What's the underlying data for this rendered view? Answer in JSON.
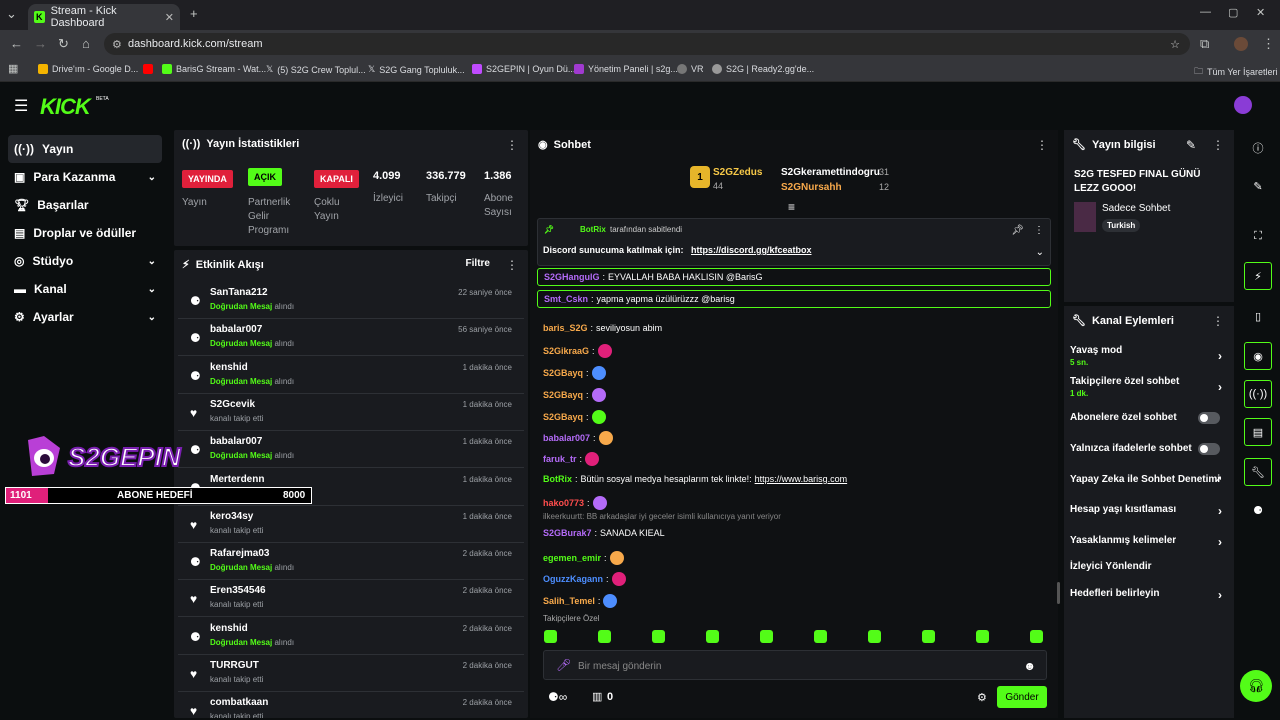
{
  "browser": {
    "tab_title": "Stream - Kick Dashboard",
    "url": "dashboard.kick.com/stream",
    "bookmarks": [
      "Drive'ım - Google D...",
      "BarisG Stream - Wat...",
      "(5) S2G Crew Toplul...",
      "S2G Gang Topluluk...",
      "S2GEPIN | Oyun Dü...",
      "Yönetim Paneli | s2g...",
      "VR",
      "S2G | Ready2.gg'de..."
    ],
    "all_bookmarks": "Tüm Yer İşaretleri"
  },
  "logo": "KICK",
  "beta": "BETA",
  "sidebar": {
    "items": [
      "Yayın",
      "Para Kazanma",
      "Başarılar",
      "Droplar ve ödüller",
      "Stüdyo",
      "Kanal",
      "Ayarlar"
    ]
  },
  "stats": {
    "title": "Yayın İstatistikleri",
    "badges": [
      "YAYINDA",
      "AÇIK",
      "KAPALI"
    ],
    "labels": [
      "Yayın",
      "Partnerlik Gelir Programı",
      "Çoklu Yayın",
      "İzleyici",
      "Takipçi",
      "Abone Sayısı"
    ],
    "values": [
      "4.099",
      "336.779",
      "1.386"
    ]
  },
  "activity": {
    "title": "Etkinlik Akışı",
    "filter": "Filtre",
    "rows": [
      {
        "user": "SanTana212",
        "type": "dm",
        "time": "22 saniye önce"
      },
      {
        "user": "babalar007",
        "type": "dm",
        "time": "56 saniye önce"
      },
      {
        "user": "kenshid",
        "type": "dm",
        "time": "1 dakika önce"
      },
      {
        "user": "S2Gcevik",
        "type": "follow",
        "time": "1 dakika önce"
      },
      {
        "user": "babalar007",
        "type": "dm",
        "time": "1 dakika önce"
      },
      {
        "user": "Merterdenn",
        "type": "dm",
        "time": "1 dakika önce"
      },
      {
        "user": "kero34sy",
        "type": "follow",
        "time": "1 dakika önce"
      },
      {
        "user": "Rafarejma03",
        "type": "dm",
        "time": "2 dakika önce"
      },
      {
        "user": "Eren354546",
        "type": "follow",
        "time": "2 dakika önce"
      },
      {
        "user": "kenshid",
        "type": "dm",
        "time": "2 dakika önce"
      },
      {
        "user": "TURRGUT",
        "type": "follow",
        "time": "2 dakika önce"
      },
      {
        "user": "combatkaan",
        "type": "follow",
        "time": "2 dakika önce"
      }
    ],
    "dm_bold": "Doğrudan Mesaj",
    "dm_rest": "alındı",
    "follow_text": "kanalı takip etti"
  },
  "overlay": {
    "logo_text": "S2GEPIN",
    "goal_current": "1101",
    "goal_label": "ABONE HEDEFİ",
    "goal_target": "8000",
    "goal_fraction": 0.1376
  },
  "chat": {
    "title": "Sohbet",
    "leaders": [
      {
        "name": "S2GZedus",
        "count": "44",
        "rank": "1"
      },
      {
        "name": "S2Gkeramettindogru",
        "count": "31"
      },
      {
        "name": "S2GNursahh",
        "count": "12"
      }
    ],
    "pinned_by": "BotRix",
    "pinned_suffix": "tarafından sabitlendi",
    "pinned_text": "Discord sunucuma katılmak için:",
    "pinned_link": "https://discord.gg/kfceatbox",
    "messages": [
      {
        "user": "S2GHangulG",
        "color": "#b46bf8",
        "text": "EYVALLAH BABA HAKLISIN @BarisG"
      },
      {
        "user": "Smt_Cskn",
        "color": "#b46bf8",
        "text": "yapma yapma üzülürüzzz @barisg"
      },
      {
        "user": "baris_S2G",
        "color": "#f7a94b",
        "text": "seviliyosun abim"
      },
      {
        "user": "S2GikraaG",
        "color": "#f7a94b",
        "text": ""
      },
      {
        "user": "S2GBayq",
        "color": "#f7a94b",
        "text": ""
      },
      {
        "user": "S2GBayq",
        "color": "#f7a94b",
        "text": ""
      },
      {
        "user": "S2GBayq",
        "color": "#f7a94b",
        "text": ""
      },
      {
        "user": "babalar007",
        "color": "#b46bf8",
        "text": ""
      },
      {
        "user": "faruk_tr",
        "color": "#b46bf8",
        "text": ""
      },
      {
        "user": "BotRix",
        "color": "#53fc18",
        "text": "Bütün sosyal medya hesaplarım tek linkte!:",
        "link": "https://www.barisg.com"
      },
      {
        "user": "hako0773",
        "color": "#ff4d4d",
        "text": ""
      },
      {
        "user": "S2GBurak7",
        "color": "#b46bf8",
        "text": "SANADA KIEAL"
      },
      {
        "user": "egemen_emir",
        "color": "#53fc18",
        "text": ""
      },
      {
        "user": "OguzzKagann",
        "color": "#4d8eff",
        "text": ""
      },
      {
        "user": "Salih_Temel",
        "color": "#f7a94b",
        "text": ""
      }
    ],
    "reply_hint": "ilkeerkuurtt: BB arkadaşlar iyi geceler isimli kullanıcıya yanıt veriyor",
    "followers_only": "Takipçilere Özel",
    "placeholder": "Bir mesaj gönderin",
    "count": "0",
    "send": "Gönder"
  },
  "info": {
    "title": "Yayın bilgisi",
    "stream_title": "S2G TESFED FINAL GÜNÜ LEZZ GOOO!",
    "category": "Sadece Sohbet",
    "tag": "Turkish"
  },
  "actions": {
    "title": "Kanal Eylemleri",
    "rows": [
      {
        "label": "Yavaş mod",
        "sub": "5 sn."
      },
      {
        "label": "Takipçilere özel sohbet",
        "sub": "1 dk."
      },
      {
        "label": "Abonelere özel sohbet"
      },
      {
        "label": "Yalnızca ifadelerle sohbet"
      },
      {
        "label": "Yapay Zeka ile Sohbet Denetimi"
      },
      {
        "label": "Hesap yaşı kısıtlaması"
      },
      {
        "label": "Yasaklanmış kelimeler"
      },
      {
        "label": "İzleyici Yönlendir"
      },
      {
        "label": "Hedefleri belirleyin"
      }
    ]
  },
  "colors": {
    "accent": "#53fc18",
    "live": "#e0203b",
    "panel": "#191b1f"
  }
}
